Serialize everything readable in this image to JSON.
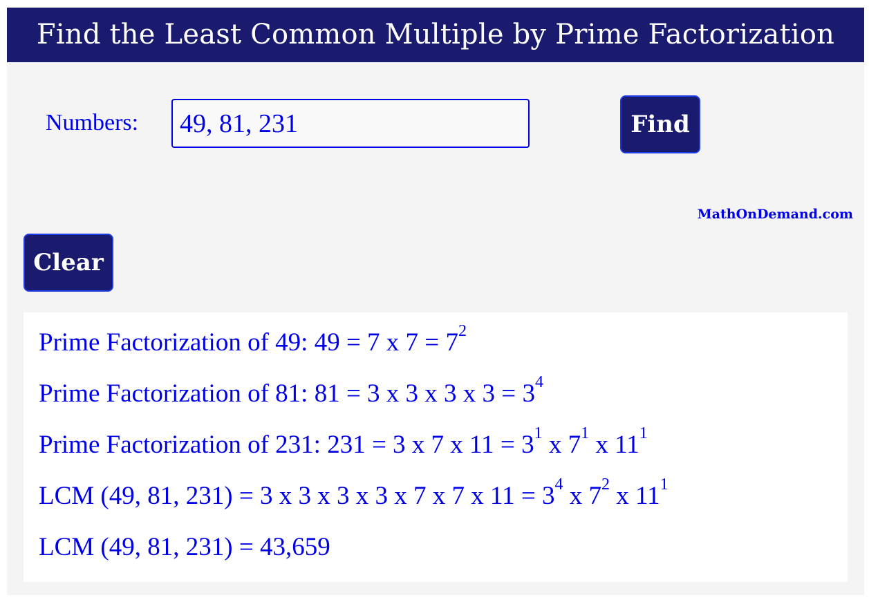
{
  "header": {
    "title": "Find the Least Common Multiple by Prime Factorization"
  },
  "form": {
    "numbers_label": "Numbers:",
    "numbers_value": "49, 81, 231",
    "find_label": "Find",
    "clear_label": "Clear"
  },
  "brand": {
    "text": "MathOnDemand.com"
  },
  "results": {
    "line1": {
      "text": "Prime Factorization of 49: 49 = 7 x 7 = ",
      "terms": [
        {
          "base": "7",
          "exp": "2",
          "sep": ""
        }
      ]
    },
    "line2": {
      "text": "Prime Factorization of 81: 81 = 3 x 3 x 3 x 3 = ",
      "terms": [
        {
          "base": "3",
          "exp": "4",
          "sep": ""
        }
      ]
    },
    "line3": {
      "text": "Prime Factorization of 231: 231 = 3 x 7 x 11 = ",
      "terms": [
        {
          "base": "3",
          "exp": "1",
          "sep": " x "
        },
        {
          "base": "7",
          "exp": "1",
          "sep": " x "
        },
        {
          "base": "11",
          "exp": "1",
          "sep": ""
        }
      ]
    },
    "line4": {
      "text": "LCM (49, 81, 231) = 3 x 3 x 3 x 3 x 7 x 7 x 11 = ",
      "terms": [
        {
          "base": "3",
          "exp": "4",
          "sep": " x "
        },
        {
          "base": "7",
          "exp": "2",
          "sep": " x "
        },
        {
          "base": "11",
          "exp": "1",
          "sep": ""
        }
      ]
    },
    "line5": {
      "text": "LCM (49, 81, 231) = 43,659"
    }
  },
  "colors": {
    "header_bg": "#1a1a6e",
    "accent_text": "#0000e6",
    "panel_bg": "#f4f4f4",
    "button_border": "#1a3adf"
  }
}
